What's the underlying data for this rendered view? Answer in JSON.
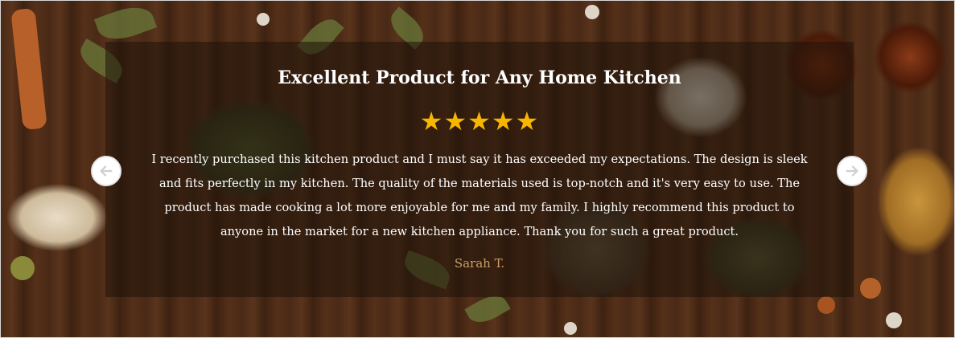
{
  "testimonial": {
    "title": "Excellent Product for Any Home Kitchen",
    "rating": 5,
    "rating_max": 5,
    "review": "I recently purchased this kitchen product and I must say it has exceeded my expectations. The design is sleek and fits perfectly in my kitchen. The quality of the materials used is top-notch and it's very easy to use. The product has made cooking a lot more enjoyable for me and my family. I highly recommend this product to anyone in the market for a new kitchen appliance. Thank you for such a great product.",
    "author": "Sarah T."
  },
  "controls": {
    "prev_icon": "arrow-left-icon",
    "next_icon": "arrow-right-icon"
  },
  "colors": {
    "star": "#f7b500",
    "author": "#c9a064",
    "overlay": "rgba(30, 18, 10, 0.55)"
  }
}
